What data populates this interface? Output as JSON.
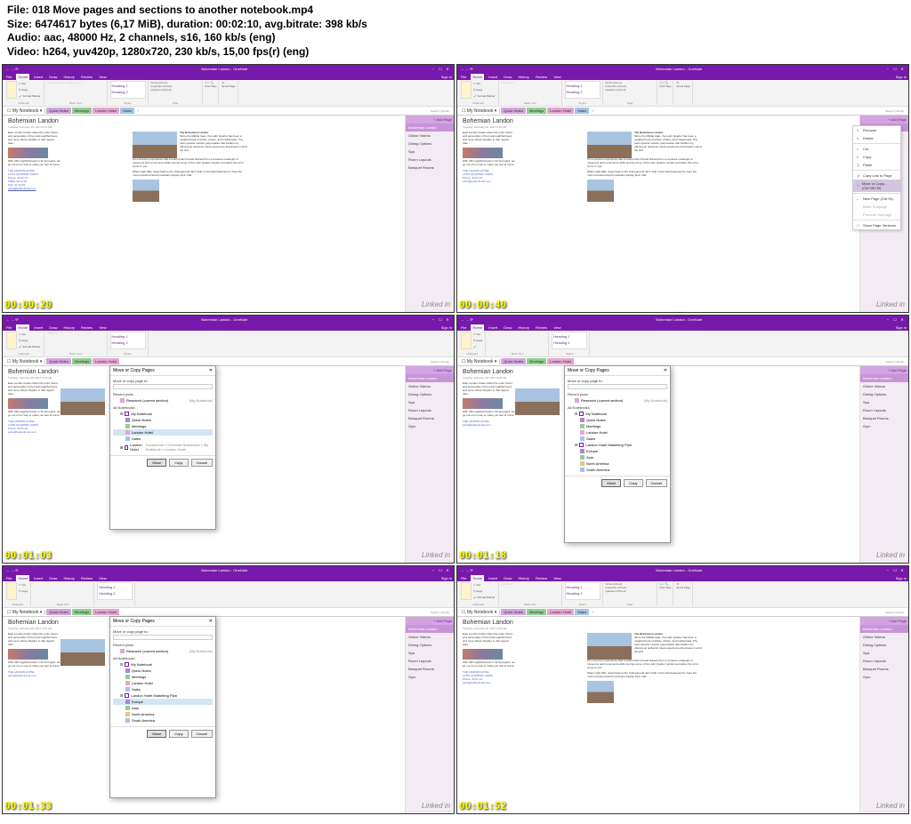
{
  "meta": {
    "file_label": "File:",
    "file_value": "018 Move pages and sections to another notebook.mp4",
    "size_label": "Size:",
    "size_value": "6474617 bytes (6,17 MiB), duration: 00:02:10, avg.bitrate: 398 kb/s",
    "audio_label": "Audio:",
    "audio_value": "aac, 48000 Hz, 2 channels, s16, 160 kb/s (eng)",
    "video_label": "Video:",
    "video_value": "h264, yuv420p, 1280x720, 230 kb/s, 15,00 fps(r) (eng)"
  },
  "app": {
    "window_title": "Bohemian Landon - OneNote",
    "sign_in": "Sign in",
    "menu": {
      "file": "File",
      "home": "Home",
      "insert": "Insert",
      "draw": "Draw",
      "history": "History",
      "review": "Review",
      "view": "View"
    },
    "ribbon": {
      "cut": "Cut",
      "copy": "Copy",
      "format_painter": "Format Painter",
      "clipboard": "Clipboard",
      "basic_text": "Basic Text",
      "heading1": "Heading 1",
      "heading2": "Heading 2",
      "styles": "Styles",
      "todo": "To Do (Ctrl+1)",
      "important": "Important (Ctrl+2)",
      "question": "Question (Ctrl+3)",
      "find_tags": "Find Tags",
      "tags": "Tags",
      "email_page": "Email Page"
    },
    "notebook": "My Notebook",
    "notebook_dd": "▾",
    "sections": {
      "quick_notes": "Quick Notes",
      "meetings": "Meetings",
      "landon_hotel": "Landon Hotel",
      "sales": "Sales",
      "add": "+"
    },
    "search": "Search (Ctrl+E)"
  },
  "page": {
    "title": "Bohemian Landon",
    "date": "Tuesday, February 28, 2017    8:16 AM",
    "para1": "East London hotels reflect the color, flavor, and personality of the local neighborhood, and none shines brighter in that regard than...",
    "para2": "With 436 neighborhoods in 32 boroughs, we go out of our way to make you feel at home.",
    "hotel": "THE LANDON HOTEL",
    "hotel_addr": "LATIN QUARTER, PARIS",
    "phone1": "Phone: 33 01 23",
    "phone2": "FREE: 08 11 23",
    "fax": "FAX: 01 23 45",
    "email": "paris@landonhotel.com",
    "right_title": "The Bohemian Landon",
    "right_para": "Since the Middle Ages, the Latin Quarter has been a neighborhood of artists, writers, and intellectuals. The Latin Quarter Landon perpetuates that tradition by offering an authentic travel experience that draws in all of the arts.",
    "right_para2": "It's a common experience that a tourist finds himself drained from a constant onslaught of museums and monuments while touring some of the Latin Quarter Landon and allow the art to come to you.",
    "right_para3": "When night falls, travel back to the Underground Jazz Club in the hotel basement to hear the most renowned world musicians display their craft."
  },
  "page_panel": {
    "add_page": "+ Add Page",
    "items": [
      "Bohemian Landon",
      "Online Videos",
      "Dining Options",
      "Spa",
      "Room Layouts",
      "Banquet Rooms",
      "Gym"
    ]
  },
  "context_menu": {
    "rename": "Rename",
    "delete": "Delete",
    "cut": "Cut",
    "copy": "Copy",
    "paste": "Paste",
    "copy_link": "Copy Link to Page",
    "move_copy": "Move or Copy... (Ctrl+Alt+M)",
    "new_page": "New Page (Ctrl+N)",
    "subpage": "Make Subpage",
    "promote": "Promote Subpage",
    "show_versions": "Show Page Versions"
  },
  "dialog": {
    "title": "Move or Copy Pages",
    "label": "Move or copy page to:",
    "recent": "Recent picks",
    "recent_item": "Research (current section)",
    "recent_nb": "(My Notebook)",
    "all_notebooks": "All Notebooks",
    "tree": {
      "my_notebook": "My Notebook",
      "quick_notes": "Quick Notes",
      "meetings": "Meetings",
      "landon_hotel": "Landon Hotel",
      "sales": "Sales",
      "landon_plan": "Landon Hotel Marketing Plan",
      "europe": "Europe",
      "asia": "Asia",
      "north_america": "North America",
      "south_america": "South America",
      "path": "Documents » OneNote Notebooks » My Notebook » Landon Hotel"
    },
    "move": "Move",
    "copy_btn": "Copy",
    "cancel": "Cancel"
  },
  "timecodes": [
    "00:00:20",
    "00:00:40",
    "00:01:03",
    "00:01:18",
    "00:01:33",
    "00:01:52"
  ],
  "watermark": "Linked in"
}
